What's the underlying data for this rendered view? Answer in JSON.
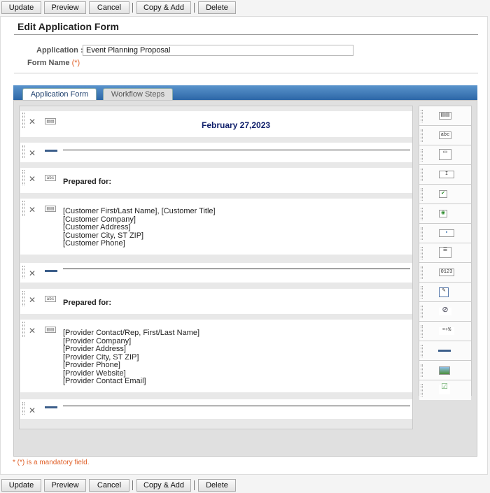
{
  "toolbar": {
    "update": "Update",
    "preview": "Preview",
    "cancel": "Cancel",
    "copy_add": "Copy & Add",
    "delete": "Delete"
  },
  "page_title": "Edit Application Form",
  "application_label": "Application",
  "application_value": "Event Planning Proposal",
  "form_name_label": "Form Name",
  "required_marker": "(*)",
  "tabs": [
    "Application Form",
    "Workflow Steps"
  ],
  "rows": {
    "date": "February 27,2023",
    "prepared_for_1": "Prepared for:",
    "customer": [
      "[Customer First/Last Name], [Customer Title]",
      "[Customer Company]",
      "[Customer Address]",
      "[Customer City, ST ZIP]",
      "[Customer Phone]"
    ],
    "prepared_for_2": "Prepared for:",
    "provider": [
      "[Provider Contact/Rep, First/Last Name]",
      "[Provider Company]",
      "[Provider Address]",
      "[Provider City, ST ZIP]",
      "[Provider Phone]",
      "[Provider Website]",
      "[Provider Contact Email]"
    ]
  },
  "icons": {
    "text_field": "abc",
    "number_field": "0123",
    "formula_field": "×+%"
  },
  "palette_items": [
    "rich-text-icon",
    "text-label-icon",
    "textarea-icon",
    "text-input-icon",
    "checkbox-icon",
    "radio-icon",
    "dropdown-icon",
    "listbox-icon",
    "number-field-icon",
    "date-picker-icon",
    "attachment-icon",
    "formula-icon",
    "separator-icon",
    "image-icon",
    "user-picker-icon"
  ],
  "mandatory_note": "* (*) is a mandatory field.",
  "colors": {
    "accent": "#2d67a7",
    "required": "#e0622b",
    "date_text": "#0f1f6b"
  }
}
